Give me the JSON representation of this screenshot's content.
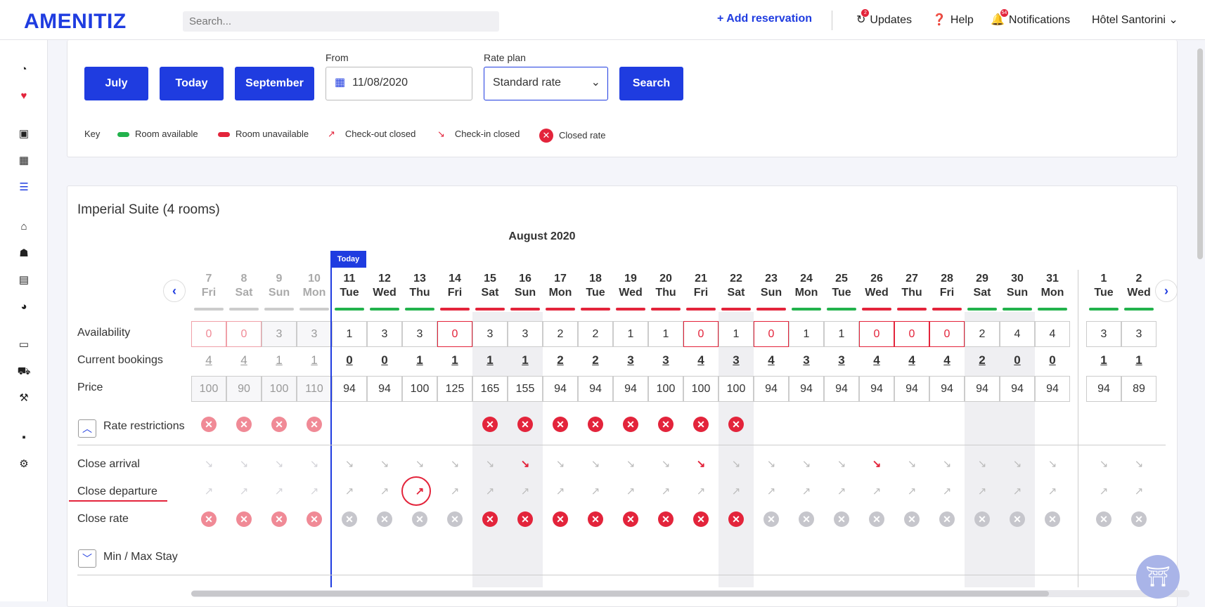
{
  "topbar": {
    "logo": "AMENITIZ",
    "search_placeholder": "Search...",
    "add_reservation": "Add reservation",
    "updates": "Updates",
    "updates_badge": "2",
    "help": "Help",
    "notifications": "Notifications",
    "notifications_badge": "54",
    "hotel": "Hôtel Santorini"
  },
  "controls": {
    "prev_month": "July",
    "today": "Today",
    "next_month": "September",
    "from_label": "From",
    "from_value": "11/08/2020",
    "rate_plan_label": "Rate plan",
    "rate_plan_value": "Standard rate",
    "search": "Search"
  },
  "key": {
    "label": "Key",
    "room_available": "Room available",
    "room_unavailable": "Room unavailable",
    "checkout_closed": "Check-out closed",
    "checkin_closed": "Check-in closed",
    "closed_rate": "Closed rate"
  },
  "colors": {
    "accent": "#1f3ce0",
    "red": "#e3243b",
    "green": "#22b24c"
  },
  "section": {
    "title": "Imperial Suite (4 rooms)",
    "month": "August 2020",
    "today_badge": "Today"
  },
  "rows": {
    "availability": "Availability",
    "bookings": "Current bookings",
    "price": "Price",
    "rate_restrictions": "Rate restrictions",
    "close_arrival": "Close arrival",
    "close_departure": "Close departure",
    "close_rate": "Close rate",
    "min_max_stay": "Min / Max Stay"
  },
  "days": [
    {
      "d": "7",
      "n": "Fri",
      "avail": "0",
      "book": "4",
      "price": "100",
      "bar": "grey",
      "past": true,
      "restr": true,
      "arr": "pale",
      "dep": "pale",
      "rate": "pale"
    },
    {
      "d": "8",
      "n": "Sat",
      "avail": "0",
      "book": "4",
      "price": "90",
      "bar": "grey",
      "past": true,
      "restr": true,
      "arr": "pale",
      "dep": "pale",
      "rate": "pale"
    },
    {
      "d": "9",
      "n": "Sun",
      "avail": "3",
      "book": "1",
      "price": "100",
      "bar": "grey",
      "past": true,
      "restr": true,
      "arr": "pale",
      "dep": "pale",
      "rate": "pale"
    },
    {
      "d": "10",
      "n": "Mon",
      "avail": "3",
      "book": "1",
      "price": "110",
      "bar": "grey",
      "past": true,
      "restr": true,
      "arr": "pale",
      "dep": "pale",
      "rate": "pale"
    },
    {
      "d": "11",
      "n": "Tue",
      "avail": "1",
      "book": "0",
      "price": "94",
      "bar": "green",
      "past": false,
      "restr": false,
      "arr": "grey",
      "dep": "grey",
      "rate": "grey"
    },
    {
      "d": "12",
      "n": "Wed",
      "avail": "3",
      "book": "0",
      "price": "94",
      "bar": "green",
      "past": false,
      "restr": false,
      "arr": "grey",
      "dep": "grey",
      "rate": "grey"
    },
    {
      "d": "13",
      "n": "Thu",
      "avail": "3",
      "book": "1",
      "price": "100",
      "bar": "green",
      "past": false,
      "restr": false,
      "arr": "grey",
      "dep": "red",
      "rate": "grey"
    },
    {
      "d": "14",
      "n": "Fri",
      "avail": "0",
      "book": "1",
      "price": "125",
      "bar": "red",
      "past": false,
      "restr": false,
      "arr": "grey",
      "dep": "grey",
      "rate": "grey"
    },
    {
      "d": "15",
      "n": "Sat",
      "avail": "3",
      "book": "1",
      "price": "165",
      "bar": "red",
      "past": false,
      "restr": true,
      "arr": "grey",
      "dep": "grey",
      "rate": "red",
      "shade": true
    },
    {
      "d": "16",
      "n": "Sun",
      "avail": "3",
      "book": "1",
      "price": "155",
      "bar": "red",
      "past": false,
      "restr": true,
      "arr": "red",
      "dep": "grey",
      "rate": "red",
      "shade": true
    },
    {
      "d": "17",
      "n": "Mon",
      "avail": "2",
      "book": "2",
      "price": "94",
      "bar": "red",
      "past": false,
      "restr": true,
      "arr": "grey",
      "dep": "grey",
      "rate": "red"
    },
    {
      "d": "18",
      "n": "Tue",
      "avail": "2",
      "book": "2",
      "price": "94",
      "bar": "red",
      "past": false,
      "restr": true,
      "arr": "grey",
      "dep": "grey",
      "rate": "red"
    },
    {
      "d": "19",
      "n": "Wed",
      "avail": "1",
      "book": "3",
      "price": "94",
      "bar": "red",
      "past": false,
      "restr": true,
      "arr": "grey",
      "dep": "grey",
      "rate": "red"
    },
    {
      "d": "20",
      "n": "Thu",
      "avail": "1",
      "book": "3",
      "price": "100",
      "bar": "red",
      "past": false,
      "restr": true,
      "arr": "grey",
      "dep": "grey",
      "rate": "red"
    },
    {
      "d": "21",
      "n": "Fri",
      "avail": "0",
      "book": "4",
      "price": "100",
      "bar": "red",
      "past": false,
      "restr": true,
      "arr": "red",
      "dep": "grey",
      "rate": "red"
    },
    {
      "d": "22",
      "n": "Sat",
      "avail": "1",
      "book": "3",
      "price": "100",
      "bar": "red",
      "past": false,
      "restr": true,
      "arr": "grey",
      "dep": "grey",
      "rate": "red",
      "shade": true
    },
    {
      "d": "23",
      "n": "Sun",
      "avail": "0",
      "book": "4",
      "price": "94",
      "bar": "red",
      "past": false,
      "restr": false,
      "arr": "grey",
      "dep": "grey",
      "rate": "grey"
    },
    {
      "d": "24",
      "n": "Mon",
      "avail": "1",
      "book": "3",
      "price": "94",
      "bar": "green",
      "past": false,
      "restr": false,
      "arr": "grey",
      "dep": "grey",
      "rate": "grey"
    },
    {
      "d": "25",
      "n": "Tue",
      "avail": "1",
      "book": "3",
      "price": "94",
      "bar": "green",
      "past": false,
      "restr": false,
      "arr": "grey",
      "dep": "grey",
      "rate": "grey"
    },
    {
      "d": "26",
      "n": "Wed",
      "avail": "0",
      "book": "4",
      "price": "94",
      "bar": "red",
      "past": false,
      "restr": false,
      "arr": "red",
      "dep": "grey",
      "rate": "grey"
    },
    {
      "d": "27",
      "n": "Thu",
      "avail": "0",
      "book": "4",
      "price": "94",
      "bar": "red",
      "past": false,
      "restr": false,
      "arr": "grey",
      "dep": "grey",
      "rate": "grey"
    },
    {
      "d": "28",
      "n": "Fri",
      "avail": "0",
      "book": "4",
      "price": "94",
      "bar": "red",
      "past": false,
      "restr": false,
      "arr": "grey",
      "dep": "grey",
      "rate": "grey"
    },
    {
      "d": "29",
      "n": "Sat",
      "avail": "2",
      "book": "2",
      "price": "94",
      "bar": "green",
      "past": false,
      "restr": false,
      "arr": "grey",
      "dep": "grey",
      "rate": "grey",
      "shade": true
    },
    {
      "d": "30",
      "n": "Sun",
      "avail": "4",
      "book": "0",
      "price": "94",
      "bar": "green",
      "past": false,
      "restr": false,
      "arr": "grey",
      "dep": "grey",
      "rate": "grey",
      "shade": true
    },
    {
      "d": "31",
      "n": "Mon",
      "avail": "4",
      "book": "0",
      "price": "94",
      "bar": "green",
      "past": false,
      "restr": false,
      "arr": "grey",
      "dep": "grey",
      "rate": "grey"
    },
    {
      "d": "1",
      "n": "Tue",
      "avail": "3",
      "book": "1",
      "price": "94",
      "bar": "green",
      "past": false,
      "restr": false,
      "arr": "grey",
      "dep": "grey",
      "rate": "grey"
    },
    {
      "d": "2",
      "n": "Wed",
      "avail": "3",
      "book": "1",
      "price": "89",
      "bar": "green",
      "past": false,
      "restr": false,
      "arr": "grey",
      "dep": "grey",
      "rate": "grey"
    }
  ]
}
